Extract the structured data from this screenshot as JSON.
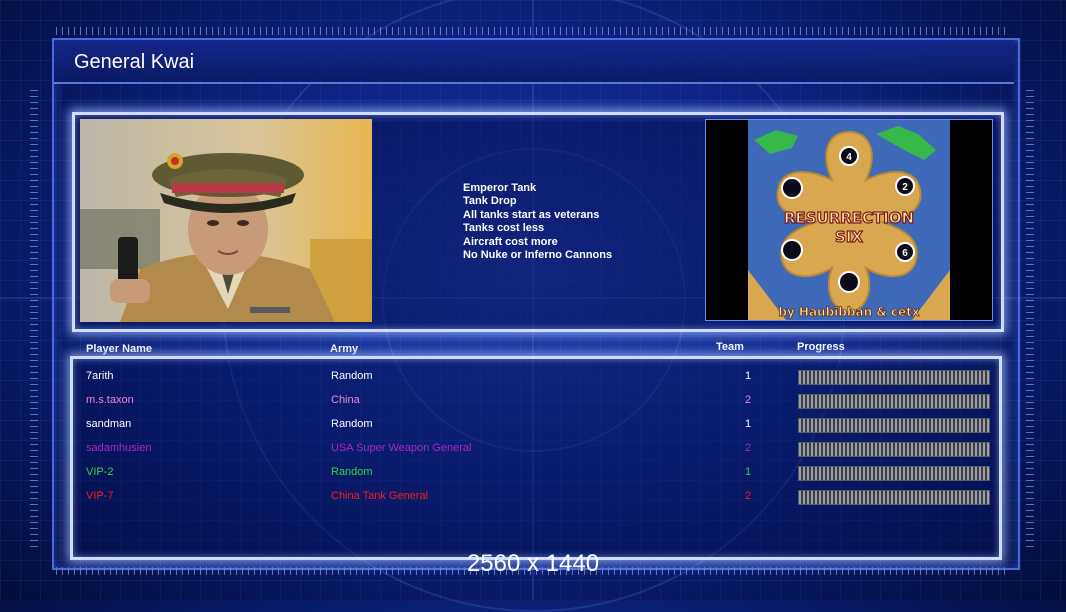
{
  "general": {
    "title": "General Kwai"
  },
  "bonuses": [
    "Emperor Tank",
    "Tank Drop",
    "All tanks start as veterans",
    "Tanks cost less",
    "Aircraft cost more",
    "No Nuke or Inferno Cannons"
  ],
  "map": {
    "name_line1": "RESURRECTION",
    "name_line2": "SIX",
    "credit": "by Haubibban & cetx",
    "start_positions": [
      "4",
      "2",
      "6"
    ]
  },
  "table": {
    "headers": {
      "player": "Player Name",
      "army": "Army",
      "team": "Team",
      "progress": "Progress"
    },
    "rows": [
      {
        "name": "7arith",
        "army": "Random",
        "team": "1",
        "color": "#ffffff",
        "progress": 1.0
      },
      {
        "name": "m.s.taxon",
        "army": "China",
        "team": "2",
        "color": "#ff7fd2",
        "progress": 1.0
      },
      {
        "name": "sandman",
        "army": "Random",
        "team": "1",
        "color": "#ffffff",
        "progress": 1.0
      },
      {
        "name": "sadamhusien",
        "army": "USA Super Weapon General",
        "team": "2",
        "color": "#b026c8",
        "progress": 1.0
      },
      {
        "name": "VIP-2",
        "army": "Random",
        "team": "1",
        "color": "#34d645",
        "progress": 1.0
      },
      {
        "name": "VIP-7",
        "army": "China Tank General",
        "team": "2",
        "color": "#ff1a1a",
        "progress": 1.0
      }
    ]
  },
  "overlay": {
    "resolution": "2560 x 1440"
  },
  "colors": {
    "panel_border": "#cfdcff",
    "background": "#0c2483",
    "map_sand": "#d9a74f"
  }
}
